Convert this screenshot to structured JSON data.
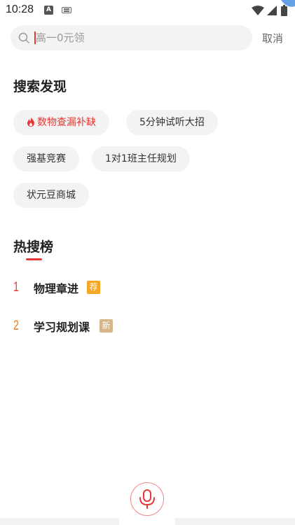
{
  "status": {
    "time": "10:28",
    "a_icon": "A"
  },
  "search": {
    "placeholder": "高一0元领",
    "value": "",
    "cancel_label": "取消"
  },
  "discover": {
    "title": "搜索发现",
    "chips": [
      {
        "label": "数物查漏补缺",
        "hot": true
      },
      {
        "label": "5分钟试听大招",
        "hot": false
      },
      {
        "label": "强基竞赛",
        "hot": false
      },
      {
        "label": "1对1班主任规划",
        "hot": false
      },
      {
        "label": "状元豆商城",
        "hot": false
      }
    ]
  },
  "hot_list": {
    "title": "热搜榜",
    "items": [
      {
        "rank": "1",
        "label": "物理章进",
        "badge": "荐",
        "rank_color": "#e53935",
        "badge_color": "#f5a623"
      },
      {
        "rank": "2",
        "label": "学习规划课",
        "badge": "新",
        "rank_color": "#f07c1a",
        "badge_color": "#d8b48a"
      }
    ]
  },
  "colors": {
    "accent": "#e53935",
    "chip_bg": "#f3f3f3"
  },
  "icons": {
    "search": "search-icon",
    "flame": "flame-icon",
    "mic": "microphone-icon"
  }
}
